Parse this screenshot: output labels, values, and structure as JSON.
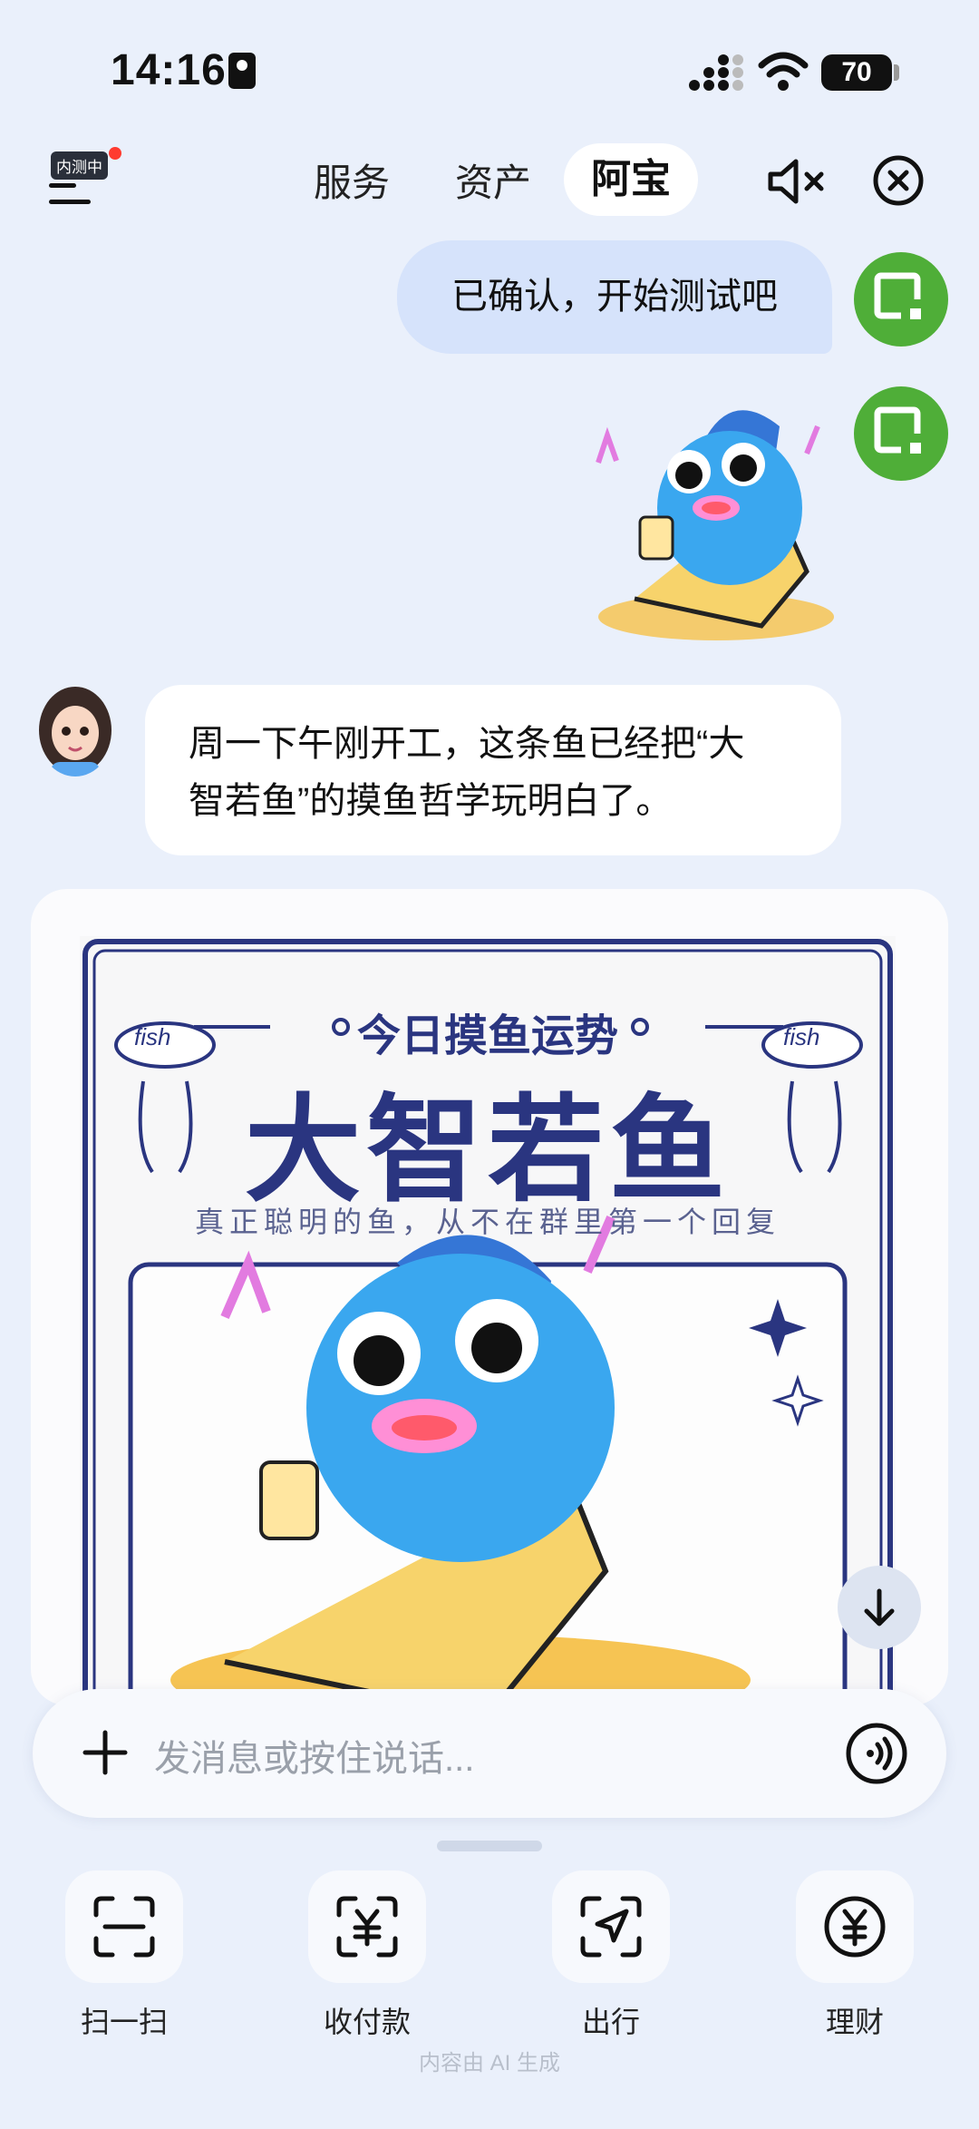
{
  "status_bar": {
    "time": "14:16",
    "battery": "70"
  },
  "header": {
    "beta_badge": "内测中",
    "tabs": [
      {
        "label": "服务"
      },
      {
        "label": "资产"
      },
      {
        "label": "阿宝",
        "active": true
      }
    ]
  },
  "chat": {
    "user_message": "已确认，开始测试吧",
    "ai_message_line1": "周一下午刚开工，这条鱼已经把“大",
    "ai_message_line2": "智若鱼”的摸鱼哲学玩明白了。",
    "poster": {
      "header_text": "今日摸鱼运势",
      "title": "大智若鱼",
      "subtitle": "真正聪明的鱼，从不在群里第一个回复",
      "fish_label": "fish"
    }
  },
  "input": {
    "placeholder": "发消息或按住说话..."
  },
  "quick_actions": [
    {
      "label": "扫一扫",
      "icon": "scan-icon"
    },
    {
      "label": "收付款",
      "icon": "payment-icon"
    },
    {
      "label": "出行",
      "icon": "travel-icon"
    },
    {
      "label": "理财",
      "icon": "finance-icon"
    }
  ],
  "footer_note": "内容由 AI 生成",
  "colors": {
    "accent": "#2a3580",
    "user_bubble": "#d6e3fb",
    "fish_blue": "#3aa7ef",
    "avatar_green": "#4fae38"
  }
}
